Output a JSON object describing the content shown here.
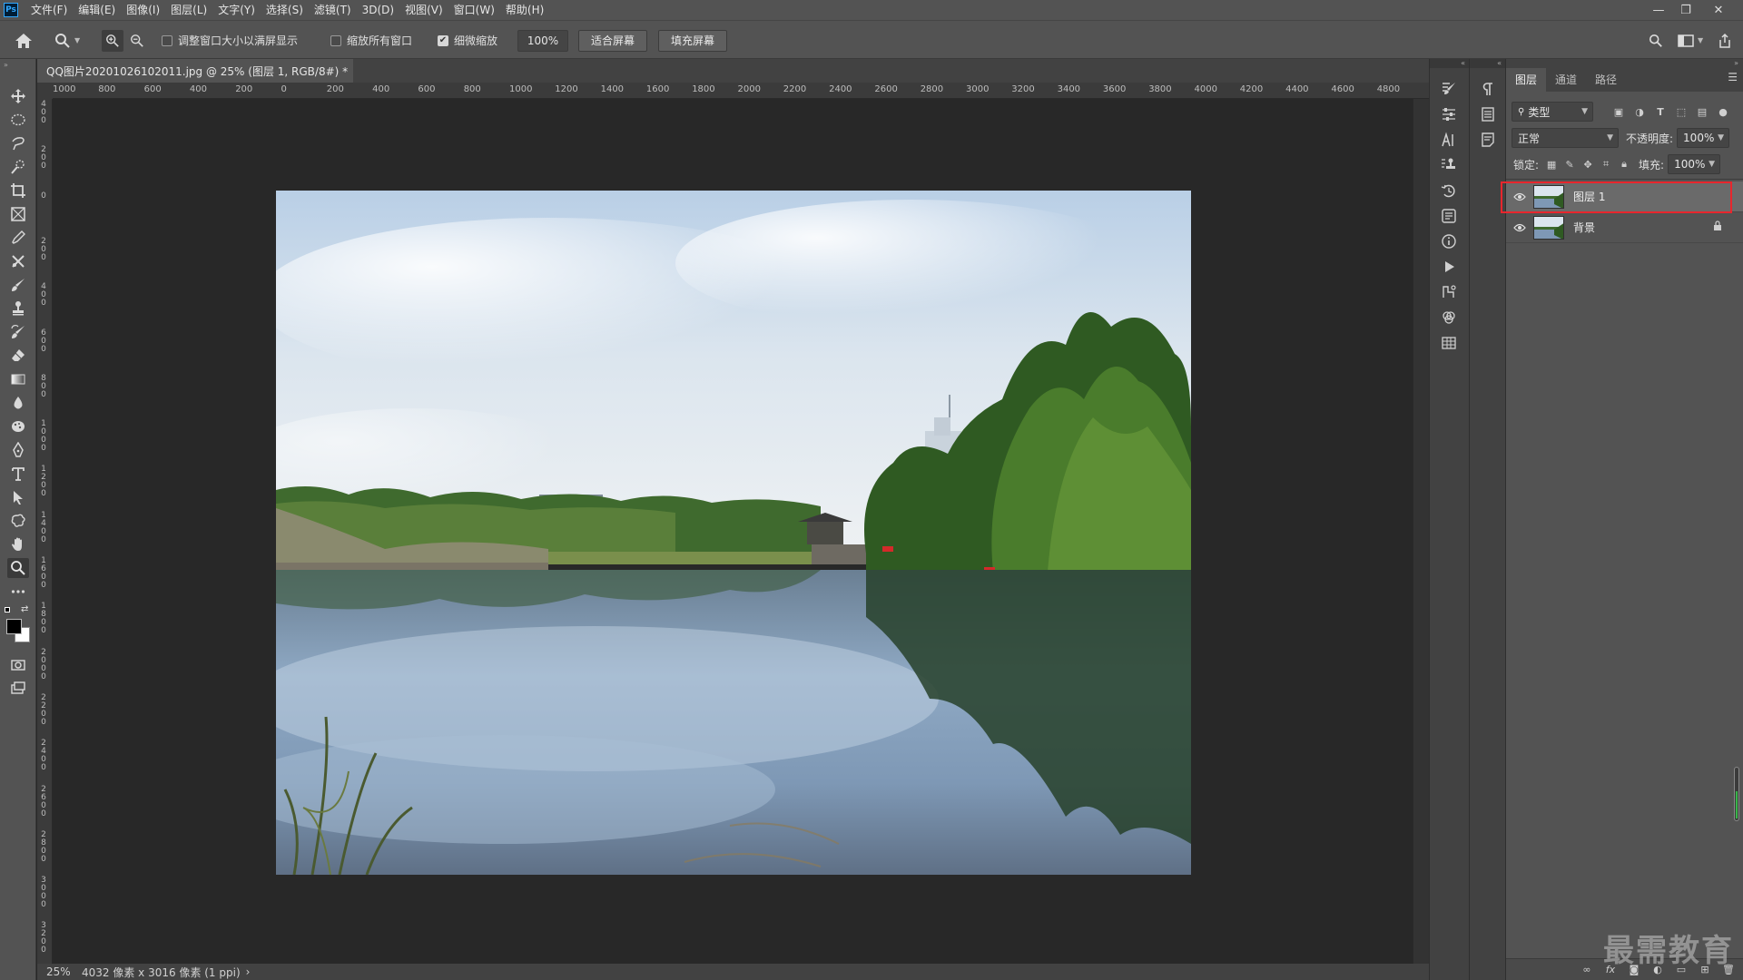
{
  "app": {
    "logo": "Ps"
  },
  "menu": [
    "文件(F)",
    "编辑(E)",
    "图像(I)",
    "图层(L)",
    "文字(Y)",
    "选择(S)",
    "滤镜(T)",
    "3D(D)",
    "视图(V)",
    "窗口(W)",
    "帮助(H)"
  ],
  "window_controls": {
    "minimize": "—",
    "restore": "❐",
    "close": "✕"
  },
  "options": {
    "resize_windows_label": "调整窗口大小以满屏显示",
    "resize_windows_checked": false,
    "zoom_all_label": "缩放所有窗口",
    "zoom_all_checked": false,
    "scrubby_zoom_label": "细微缩放",
    "scrubby_zoom_checked": true,
    "zoom_value": "100%",
    "fit_screen_label": "适合屏幕",
    "fill_screen_label": "填充屏幕"
  },
  "document": {
    "tab_title": "QQ图片20201026102011.jpg @ 25% (图层 1, RGB/8#) *",
    "tab_close": "×"
  },
  "ruler": {
    "h_labels": [
      "1000",
      "800",
      "600",
      "400",
      "200",
      "0",
      "200",
      "400",
      "600",
      "800",
      "1000",
      "1200",
      "1400",
      "1600",
      "1800",
      "2000",
      "2200",
      "2400",
      "2600",
      "2800",
      "3000",
      "3200",
      "3400",
      "3600",
      "3800",
      "4000",
      "4200",
      "4400",
      "4600",
      "4800"
    ],
    "v_labels": [
      "400",
      "200",
      "0",
      "200",
      "400",
      "600",
      "800",
      "1000",
      "1200",
      "1400",
      "1600",
      "1800",
      "2000",
      "2200",
      "2400",
      "2600",
      "2800",
      "3000",
      "3200"
    ]
  },
  "status": {
    "zoom": "25%",
    "info": "4032 像素 x 3016 像素 (1 ppi)",
    "arrow": "›"
  },
  "layers_panel": {
    "tabs": [
      "图层",
      "通道",
      "路径"
    ],
    "active_tab": "图层",
    "menu_icon": "☰",
    "filter_kind": "类型",
    "blend_mode": "正常",
    "opacity_label": "不透明度:",
    "opacity_value": "100%",
    "lock_label": "锁定:",
    "fill_label": "填充:",
    "fill_value": "100%",
    "layers": [
      {
        "name": "图层 1",
        "selected": true,
        "locked": false
      },
      {
        "name": "背景",
        "selected": false,
        "locked": true
      }
    ],
    "footer_icons": [
      "link-icon",
      "fx-icon",
      "mask-icon",
      "adjustment-icon",
      "folder-icon",
      "new-layer-icon",
      "trash-icon"
    ]
  },
  "watermark": "最需教育",
  "colors": {
    "accent_highlight": "#e8262d",
    "panel_bg": "#535353",
    "canvas_bg": "#282828"
  }
}
